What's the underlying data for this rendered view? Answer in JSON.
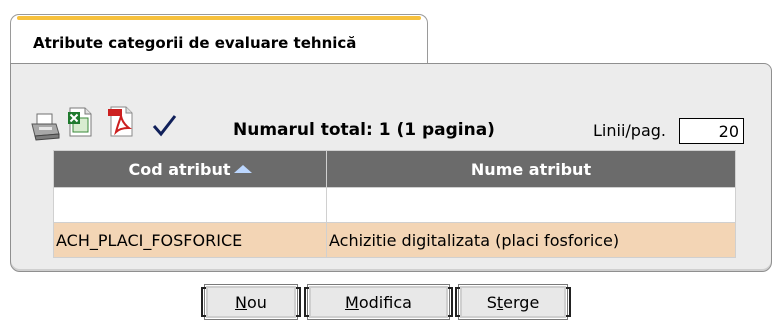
{
  "tab": {
    "title": "Atribute categorii de evaluare tehnică"
  },
  "toolbar": {
    "icons": [
      "printer-icon",
      "excel-icon",
      "pdf-icon",
      "check-icon"
    ],
    "total_label": "Numarul total: 1 (1 pagina)",
    "lines_per_page_label": "Linii/pag.",
    "lines_per_page_value": "20"
  },
  "table": {
    "columns": [
      "Cod atribut",
      "Nume atribut"
    ],
    "sort": {
      "column": "Cod atribut",
      "direction": "ascending"
    },
    "filter": [
      "",
      ""
    ],
    "rows": [
      [
        "ACH_PLACI_FOSFORICE",
        "Achizitie digitalizata (placi fosforice)"
      ]
    ]
  },
  "buttons": {
    "new_prefix": "",
    "new_key": "N",
    "new_rest": "ou",
    "modify_prefix": "",
    "modify_key": "M",
    "modify_rest": "odifica",
    "delete_prefix": "S",
    "delete_key": "t",
    "delete_rest": "erge"
  },
  "colors": {
    "tab_accent": "#f7c13d",
    "header_bg": "#6b6b6b",
    "row_bg": "#f3d5b5",
    "panel_bg": "#ececec"
  }
}
